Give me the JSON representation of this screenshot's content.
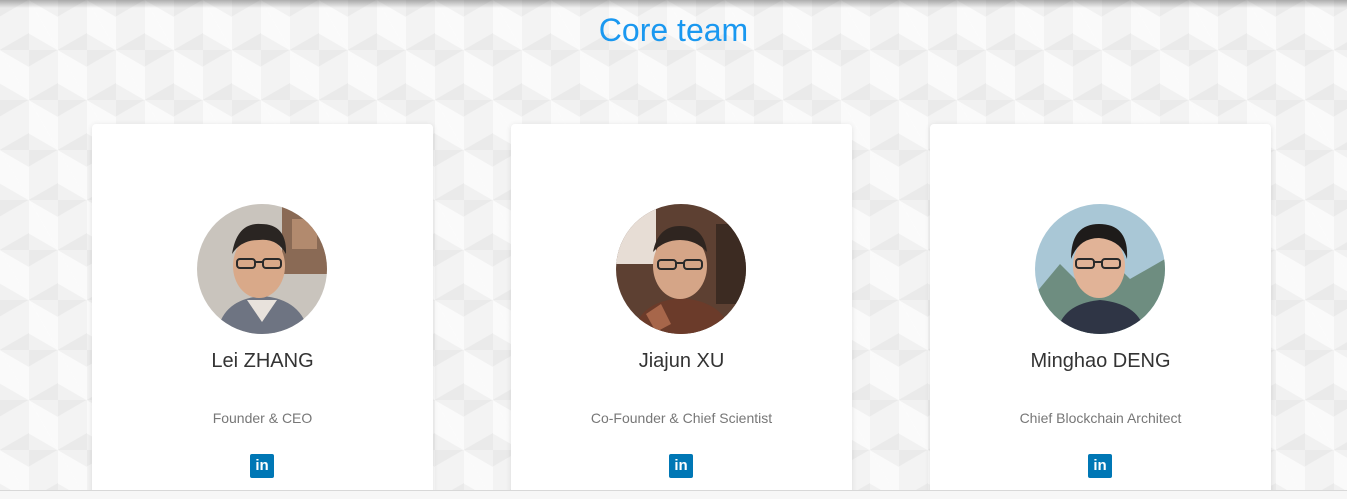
{
  "section": {
    "title": "Core team"
  },
  "team": [
    {
      "name": "Lei ZHANG",
      "role": "Founder & CEO",
      "social_icon": "linkedin-icon",
      "social_label": "in"
    },
    {
      "name": "Jiajun XU",
      "role": "Co-Founder & Chief Scientist",
      "social_icon": "linkedin-icon",
      "social_label": "in"
    },
    {
      "name": "Minghao DENG",
      "role": "Chief Blockchain Architect",
      "social_icon": "linkedin-icon",
      "social_label": "in"
    }
  ],
  "colors": {
    "title": "#1a98f0",
    "linkedin": "#0077b5",
    "card": "#ffffff"
  }
}
